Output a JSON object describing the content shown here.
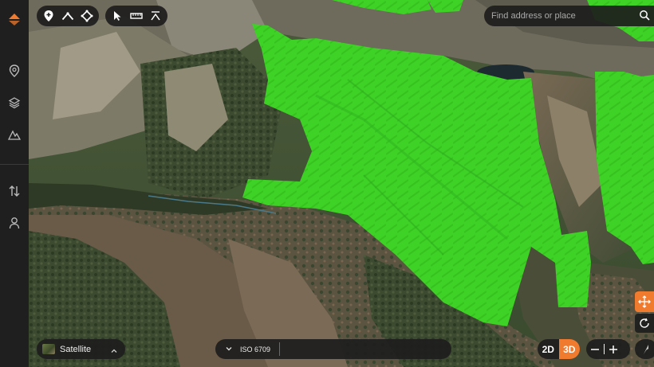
{
  "search": {
    "placeholder": "Find address or place"
  },
  "basemap": {
    "label": "Satellite"
  },
  "layer": {
    "label": "ISO 6709"
  },
  "view_mode": {
    "option_2d": "2D",
    "option_3d": "3D",
    "active": "3D"
  },
  "colors": {
    "accent": "#f07a2e",
    "overlay": "#33e022",
    "panel": "#1e1e1e"
  },
  "icons": {
    "sidebar": [
      "logo-icon",
      "location-pin-icon",
      "layers-icon",
      "terrain-icon",
      "transfer-icon",
      "user-icon"
    ],
    "toolbar_draw": [
      "add-marker-icon",
      "draw-line-icon",
      "draw-shape-icon"
    ],
    "toolbar_tools": [
      "select-cursor-icon",
      "ruler-icon",
      "elevation-profile-icon"
    ],
    "map_controls": [
      "pan-icon",
      "rotate-icon",
      "zoom-out-icon",
      "zoom-in-icon",
      "compass-icon"
    ]
  }
}
